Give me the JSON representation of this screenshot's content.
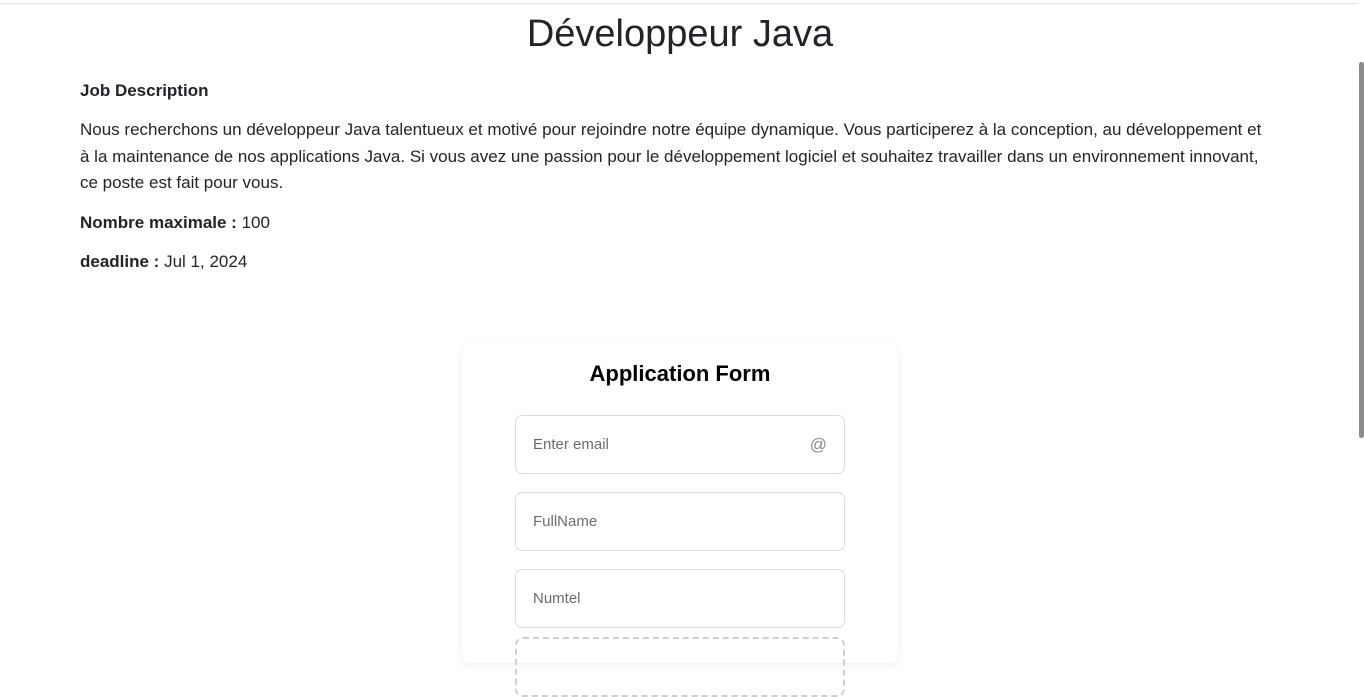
{
  "job": {
    "title": "Développeur Java",
    "description_label": "Job Description",
    "description": "Nous recherchons un développeur Java talentueux et motivé pour rejoindre notre équipe dynamique. Vous participerez à la conception, au développement et à la maintenance de nos applications Java. Si vous avez une passion pour le développement logiciel et souhaitez travailler dans un environnement innovant, ce poste est fait pour vous.",
    "max_label": "Nombre maximale :",
    "max_value": "100",
    "deadline_label": "deadline :",
    "deadline_value": "Jul 1, 2024"
  },
  "form": {
    "title": "Application Form",
    "email_placeholder": "Enter email",
    "email_icon": "at-icon",
    "email_icon_glyph": "@",
    "fullname_placeholder": "FullName",
    "numtel_placeholder": "Numtel"
  }
}
